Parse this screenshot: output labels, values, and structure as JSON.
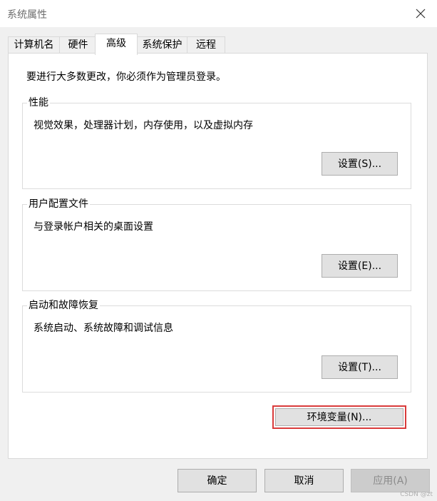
{
  "window": {
    "title": "系统属性"
  },
  "tabs": [
    {
      "label": "计算机名",
      "active": false
    },
    {
      "label": "硬件",
      "active": false
    },
    {
      "label": "高级",
      "active": true
    },
    {
      "label": "系统保护",
      "active": false
    },
    {
      "label": "远程",
      "active": false
    }
  ],
  "advanced": {
    "notice": "要进行大多数更改，你必须作为管理员登录。",
    "performance": {
      "title": "性能",
      "description": "视觉效果，处理器计划，内存使用，以及虚拟内存",
      "button": "设置(S)..."
    },
    "user_profiles": {
      "title": "用户配置文件",
      "description": "与登录帐户相关的桌面设置",
      "button": "设置(E)..."
    },
    "startup_recovery": {
      "title": "启动和故障恢复",
      "description": "系统启动、系统故障和调试信息",
      "button": "设置(T)..."
    },
    "env_button": "环境变量(N)...",
    "highlight_color": "#d93b3b"
  },
  "footer": {
    "ok": "确定",
    "cancel": "取消",
    "apply": "应用(A)"
  },
  "watermark": "CSDN @zt"
}
